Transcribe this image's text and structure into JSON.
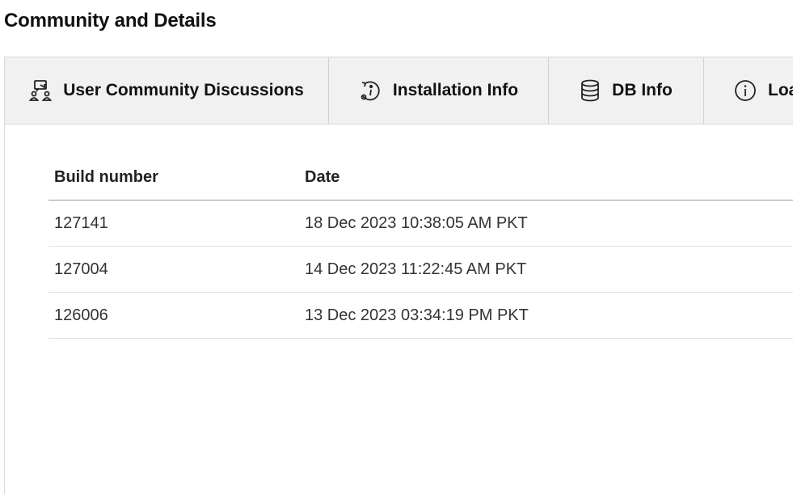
{
  "page": {
    "title": "Community and Details"
  },
  "tabs": [
    {
      "label": "User Community Discussions",
      "icon": "community-icon"
    },
    {
      "label": "Installation Info",
      "icon": "installation-info-icon"
    },
    {
      "label": "DB Info",
      "icon": "database-icon"
    },
    {
      "label": "Loa",
      "icon": "info-icon"
    }
  ],
  "table": {
    "headers": {
      "build_number": "Build number",
      "date": "Date"
    },
    "rows": [
      {
        "build_number": "127141",
        "date": "18 Dec 2023 10:38:05 AM PKT",
        "highlighted": true
      },
      {
        "build_number": "127004",
        "date": "14 Dec 2023 11:22:45 AM PKT"
      },
      {
        "build_number": "126006",
        "date": "13 Dec 2023 03:34:19 PM PKT"
      }
    ]
  },
  "colors": {
    "highlight": "#ffe600",
    "tabbar_bg": "#f1f1f1"
  }
}
